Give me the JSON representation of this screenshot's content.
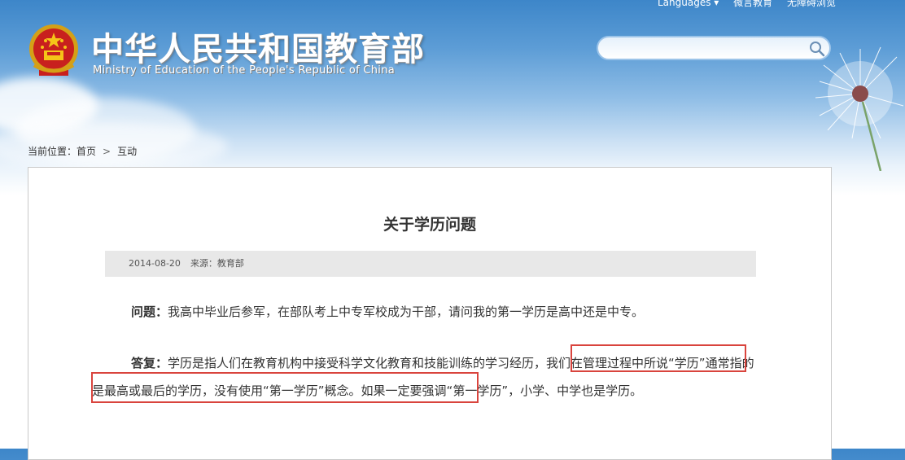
{
  "header": {
    "top_links": [
      "Languages ▾",
      "微言教育",
      "无障碍浏览"
    ],
    "title_cn": "中华人民共和国教育部",
    "title_en": "Ministry of Education of the People's Republic of China",
    "search_placeholder": ""
  },
  "breadcrumb": {
    "label": "当前位置：",
    "home": "首页",
    "separator": ">",
    "current": "互动"
  },
  "article": {
    "title": "关于学历问题",
    "date": "2014-08-20",
    "source": "来源：教育部",
    "question_label": "问题：",
    "question_text": "我高中毕业后参军，在部队考上中专军校成为干部，请问我的第一学历是高中还是中专。",
    "answer_label": "答复：",
    "answer_part1": "学历是指人们在教育机构中接受科学文化教育和技能训练的学习经历，",
    "answer_part2": "我们在管理过程中所说“学历”通常指的是最高或最后的学历，没有使用“第一学历”概念。",
    "answer_part3": "如果一定要强调“第一学历”，小学、中学也是学历。"
  },
  "colors": {
    "header_blue": "#3d86c9",
    "highlight_red": "#d9443d",
    "meta_bar_gray": "#e8e8e8"
  }
}
